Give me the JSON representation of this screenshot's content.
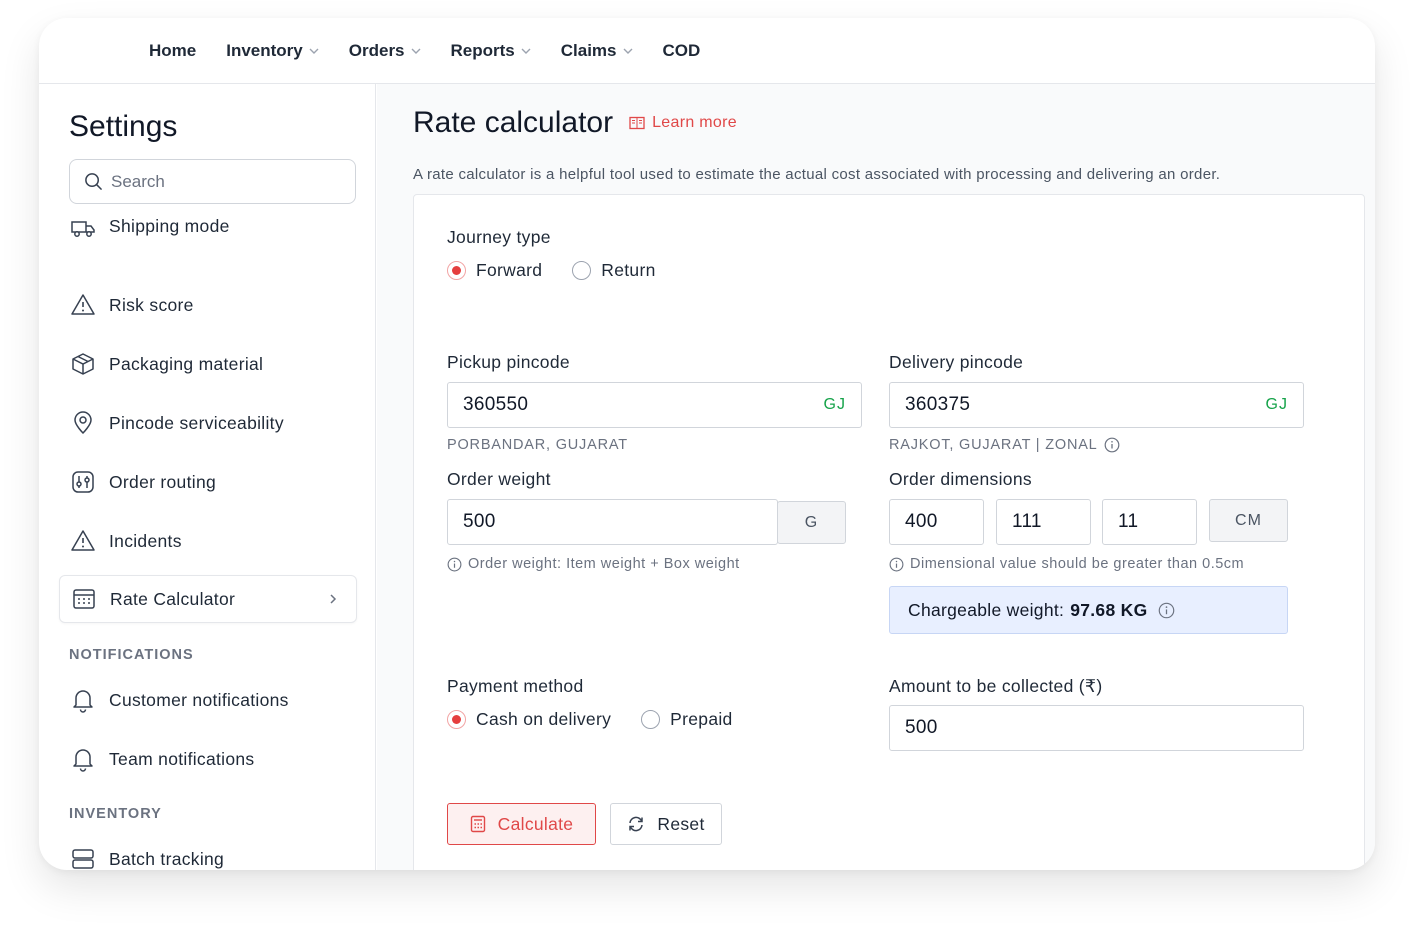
{
  "topnav": {
    "items": [
      {
        "label": "Home",
        "dropdown": false
      },
      {
        "label": "Inventory",
        "dropdown": true
      },
      {
        "label": "Orders",
        "dropdown": true
      },
      {
        "label": "Reports",
        "dropdown": true
      },
      {
        "label": "Claims",
        "dropdown": true
      },
      {
        "label": "COD",
        "dropdown": false
      }
    ]
  },
  "sidebar": {
    "title": "Settings",
    "search_placeholder": "Search",
    "items": [
      {
        "label": "Shipping mode",
        "icon": "truck-icon"
      },
      {
        "label": "Risk score",
        "icon": "warning-icon"
      },
      {
        "label": "Packaging material",
        "icon": "box-icon"
      },
      {
        "label": "Pincode serviceability",
        "icon": "location-pin-icon"
      },
      {
        "label": "Order routing",
        "icon": "routing-icon"
      },
      {
        "label": "Incidents",
        "icon": "warning-icon"
      },
      {
        "label": "Rate Calculator",
        "icon": "calculator-icon",
        "active": true
      }
    ],
    "section_notifications": "NOTIFICATIONS",
    "notification_items": [
      {
        "label": "Customer notifications",
        "icon": "bell-icon"
      },
      {
        "label": "Team notifications",
        "icon": "bell-icon"
      }
    ],
    "section_inventory": "INVENTORY",
    "inventory_items": [
      {
        "label": "Batch tracking",
        "icon": "server-icon"
      }
    ]
  },
  "main": {
    "title": "Rate calculator",
    "learn_more": "Learn more",
    "description": "A rate calculator is a helpful tool used to estimate the actual cost associated with processing and delivering an order.",
    "journey": {
      "label": "Journey type",
      "options": [
        "Forward",
        "Return"
      ],
      "selected": "Forward"
    },
    "pickup": {
      "label": "Pickup pincode",
      "value": "360550",
      "state_code": "GJ",
      "location": "PORBANDAR, GUJARAT"
    },
    "delivery": {
      "label": "Delivery pincode",
      "value": "360375",
      "state_code": "GJ",
      "location": "RAJKOT, GUJARAT | ZONAL"
    },
    "weight": {
      "label": "Order weight",
      "value": "500",
      "unit": "G",
      "hint": "Order weight: Item weight + Box weight"
    },
    "dimensions": {
      "label": "Order dimensions",
      "length": "400",
      "width": "111",
      "height": "11",
      "unit": "CM",
      "hint": "Dimensional value should be greater than 0.5cm"
    },
    "chargeable": {
      "label": "Chargeable weight:",
      "value": "97.68 KG"
    },
    "payment": {
      "label": "Payment method",
      "options": [
        "Cash on delivery",
        "Prepaid"
      ],
      "selected": "Cash on delivery"
    },
    "amount": {
      "label": "Amount to be collected (₹)",
      "value": "500"
    },
    "buttons": {
      "calculate": "Calculate",
      "reset": "Reset"
    }
  },
  "colors": {
    "accent": "#e04848",
    "badge_green": "#16a34a",
    "highlight_bg": "#e8efff"
  }
}
